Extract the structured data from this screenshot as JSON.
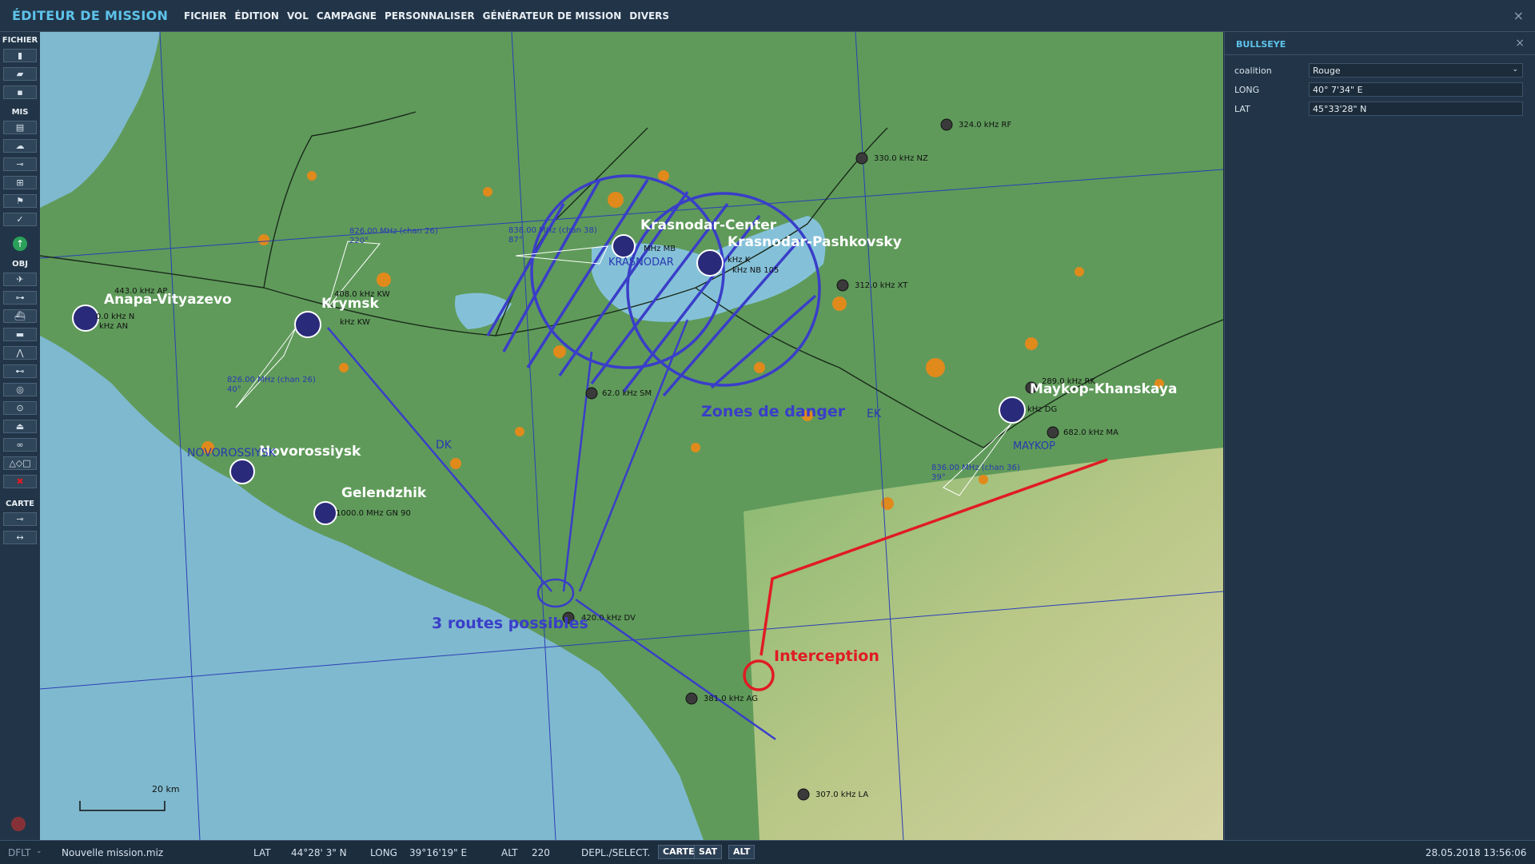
{
  "app": {
    "title": "ÉDITEUR DE MISSION",
    "close_glyph": "×"
  },
  "menu": [
    "FICHIER",
    "ÉDITION",
    "VOL",
    "CAMPAGNE",
    "PERSONNALISER",
    "GÉNÉRATEUR DE MISSION",
    "DIVERS"
  ],
  "toolbar": {
    "fichier_label": "FICHIER",
    "mis_label": "MIS",
    "obj_label": "OBJ",
    "carte_label": "CARTE",
    "fichier_icons": [
      "new-file-icon",
      "open-folder-icon",
      "save-icon"
    ],
    "mis_icons": [
      "briefing-icon",
      "weather-icon",
      "plane-group-icon",
      "ground-unit-icon",
      "trigger-flag-icon",
      "check-icon"
    ],
    "obj_icons": [
      "aircraft-icon",
      "helicopter-icon",
      "ship-icon",
      "vehicle-icon",
      "airdefense-icon",
      "static-icon",
      "target-icon",
      "zone-icon",
      "warehouse-icon",
      "formation-icon",
      "shapes-icon",
      "delete-icon"
    ],
    "carte_icons": [
      "map-key-icon",
      "measure-icon"
    ]
  },
  "right_panel": {
    "title": "BULLSEYE",
    "close_glyph": "×",
    "fields": [
      {
        "label": "coalition",
        "value": "Rouge",
        "type": "select"
      },
      {
        "label": "LONG",
        "value": "40° 7'34\" E",
        "type": "text"
      },
      {
        "label": "LAT",
        "value": "45°33'28\" N",
        "type": "text"
      }
    ]
  },
  "map": {
    "airfields": [
      "Anapa-Vityazevo",
      "Krymsk",
      "Novorossiysk",
      "Gelendzhik",
      "Krasnodar-Center",
      "Krasnodar-Pashkovsky",
      "Maykop-Khanskaya"
    ],
    "airfield_labels_display": {
      "anapa": "Anapa-Vityazevo",
      "krymsk": "Krymsk",
      "novo": "Novorossiysk",
      "gelen": "Gelendzhik",
      "kras_center": "Krasnodar-Center",
      "kras_pash": "Krasnodar-Pashkovsky",
      "maykop": "Maykop-Khanskaya"
    },
    "city_labels": {
      "novo": "NOVOROSSIYSK",
      "kras": "KRASNODAR",
      "maykop": "MAYKOP"
    },
    "nav_labels": {
      "rf": "324.0 kHz RF",
      "nz": "330.0 kHz NZ",
      "xt": "312.0 kHz XT",
      "sm": "62.0 kHz SM",
      "ma": "682.0 kHz MA",
      "rk": "289.0 kHz RK",
      "dv": "420.0 kHz DV",
      "ag": "381.0 kHz AG",
      "la": "307.0 kHz LA",
      "ap": "443.0 kHz AP",
      "an": "kHz AN",
      "n": "0.0 kHz N",
      "kw": "408.0 kHz KW",
      "kw2": "kHz KW",
      "gn": "1000.0 MHz GN 90",
      "dg": "kHz DG",
      "k105": "kHz K",
      "nb": "kHz NB 105",
      "mb": "MHz MB"
    },
    "ils_labels": {
      "krymsk": "826.00 MHz (chan 26)",
      "krymsk_hdg": "220°",
      "krymsk2": "826.00 MHz (chan 26)",
      "krymsk2_hdg": "40°",
      "kras": "838.00 MHz (chan 38)",
      "kras_hdg": "87°",
      "maykop": "836.00 MHz (chan 36)",
      "maykop_hdg": "39°"
    },
    "misc_labels": {
      "dk": "DK",
      "ek": "EK"
    },
    "annotations": {
      "danger": "Zones de danger",
      "routes": "3 routes possibles",
      "intercept": "Interception"
    },
    "scale": "20 km",
    "colors": {
      "sea": "#7fb9cf",
      "land": "#5f9a5a",
      "orange": "#e08a1c",
      "blue_annot": "#3a3ec8",
      "red_annot": "#e01b24"
    }
  },
  "statusbar": {
    "profile": "DFLT",
    "filename": "Nouvelle mission.miz",
    "lat_label": "LAT",
    "lat_value": "44°28' 3\" N",
    "long_label": "LONG",
    "long_value": "39°16'19\" E",
    "alt_label": "ALT",
    "alt_value": "220",
    "mode_label": "DEPL./SELECT.",
    "buttons": [
      "CARTE",
      "SAT",
      "ALT"
    ],
    "datetime": "28.05.2018 13:56:06"
  }
}
